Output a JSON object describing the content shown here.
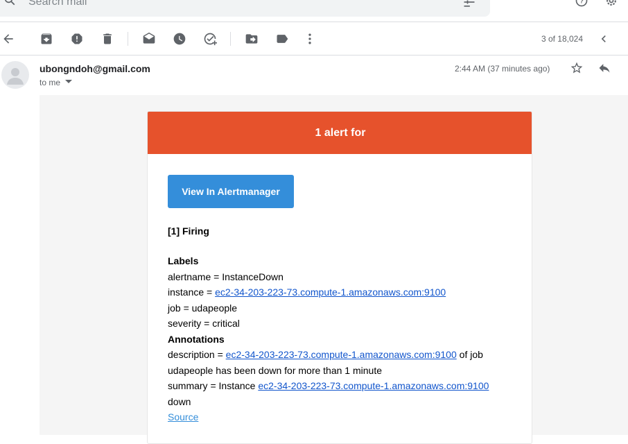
{
  "search": {
    "placeholder": "Search mail"
  },
  "toolbar": {
    "back": "arrow-left-icon",
    "actions": [
      "archive-icon",
      "report-spam-icon",
      "delete-icon",
      "mark-unread-icon",
      "snooze-icon",
      "add-task-icon",
      "move-to-icon",
      "label-icon",
      "more-icon"
    ],
    "count": "3 of 18,024"
  },
  "message": {
    "sender": "ubongndoh@gmail.com",
    "recipient": "to me",
    "time": "2:44 AM (37 minutes ago)"
  },
  "email": {
    "header": "1 alert for",
    "button": "View In Alertmanager",
    "firing": "[1] Firing",
    "labels_title": "Labels",
    "alertname": "alertname = InstanceDown",
    "instance_prefix": "instance = ",
    "instance_link": "ec2-34-203-223-73.compute-1.amazonaws.com:9100",
    "job": "job = udapeople",
    "severity": "severity = critical",
    "annotations_title": "Annotations",
    "description_prefix": "description = ",
    "description_link": "ec2-34-203-223-73.compute-1.amazonaws.com:9100",
    "description_suffix": " of job",
    "description_line2": "udapeople has been down for more than 1 minute",
    "summary_prefix": "summary = Instance ",
    "summary_link": "ec2-34-203-223-73.compute-1.amazonaws.com:9100",
    "summary_line2": "down",
    "source": "Source"
  },
  "colors": {
    "header": "#e6522c",
    "button": "#348eda",
    "link": "#1155cc"
  }
}
